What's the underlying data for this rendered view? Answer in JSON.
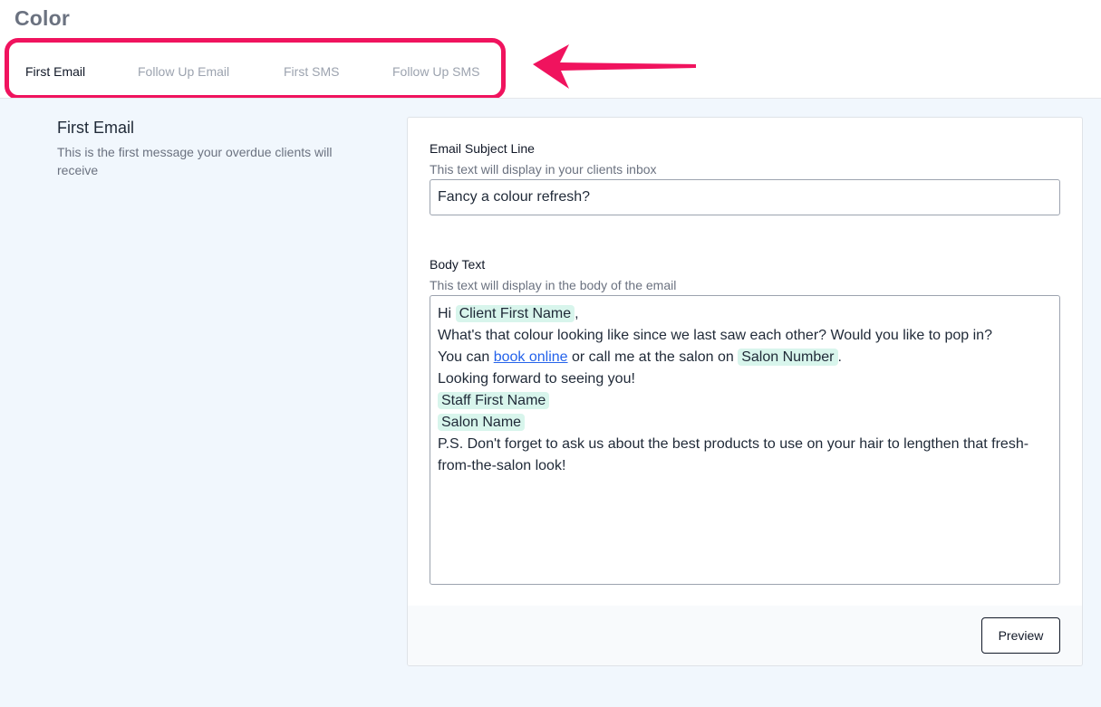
{
  "page": {
    "title": "Color"
  },
  "tabs": [
    {
      "label": "First Email",
      "active": true
    },
    {
      "label": "Follow Up Email",
      "active": false
    },
    {
      "label": "First SMS",
      "active": false
    },
    {
      "label": "Follow Up SMS",
      "active": false
    }
  ],
  "annotation": {
    "highlight_color": "#f0135e",
    "arrow_color": "#f0135e"
  },
  "section": {
    "title": "First Email",
    "description": "This is the first message your overdue clients will receive"
  },
  "subject": {
    "label": "Email Subject Line",
    "help": "This text will display in your clients inbox",
    "value": "Fancy a colour refresh?"
  },
  "body": {
    "label": "Body Text",
    "help": "This text will display in the body of the email",
    "greeting": "Hi",
    "tag_client_first_name": "Client First Name",
    "comma": ",",
    "line2": "What's that colour looking like since we last saw each other? Would you like to pop in?",
    "line3_prefix": "You can",
    "link_book_online": "book online",
    "line3_middle": "or call me at the salon on",
    "tag_salon_number": "Salon Number",
    "period": ".",
    "line4": "Looking forward to seeing you!",
    "tag_staff_first_name": "Staff First Name",
    "tag_salon_name": "Salon Name",
    "line7": "P.S. Don't forget to ask us about the best products to use on your hair to lengthen that fresh-from-the-salon look!"
  },
  "footer": {
    "preview_label": "Preview"
  },
  "colors": {
    "tag_bg": "#d8f5ec",
    "link": "#2563eb",
    "content_bg": "#f1f7fd"
  }
}
